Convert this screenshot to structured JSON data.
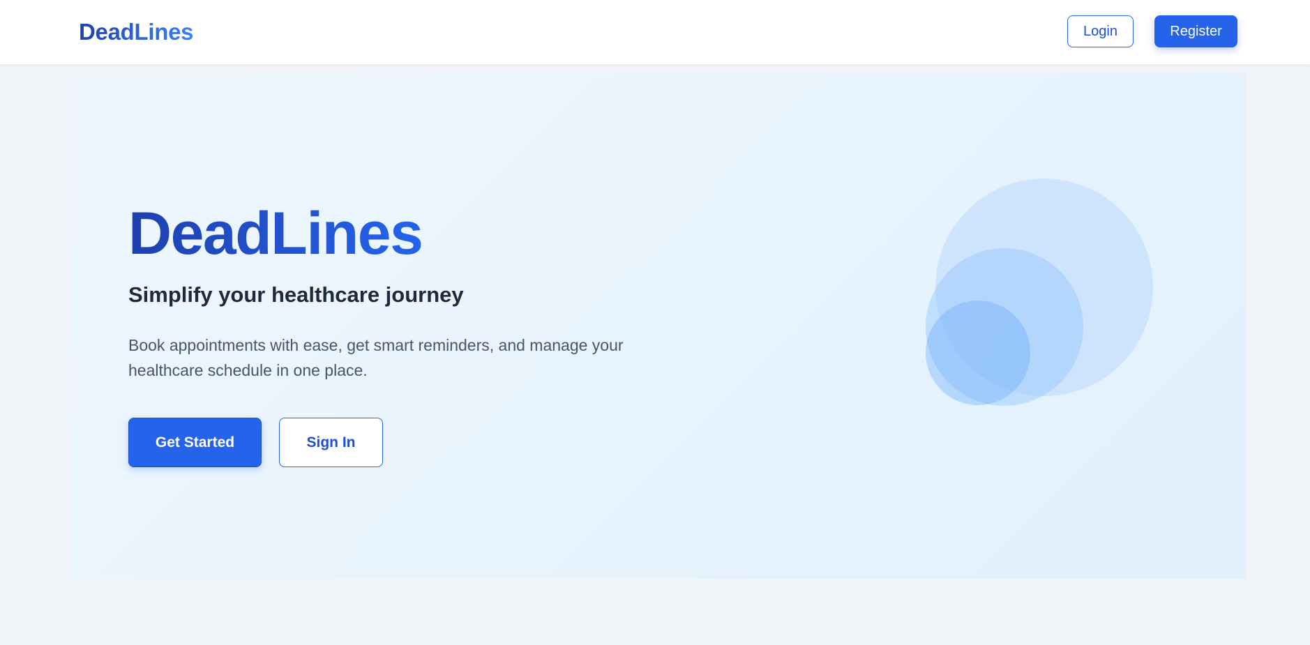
{
  "header": {
    "brand": "DeadLines",
    "login_label": "Login",
    "register_label": "Register"
  },
  "hero": {
    "title": "DeadLines",
    "subtitle": "Simplify your healthcare journey",
    "description": "Book appointments with ease, get smart reminders, and manage your healthcare schedule in one place.",
    "primary_button": "Get Started",
    "secondary_button": "Sign In"
  },
  "colors": {
    "primary": "#2563eb",
    "primary_dark": "#1e40af",
    "page_background": "#f1f5f9",
    "hero_background": "#e8f4fd",
    "text_dark": "#1e293b",
    "text_muted": "#475569"
  }
}
